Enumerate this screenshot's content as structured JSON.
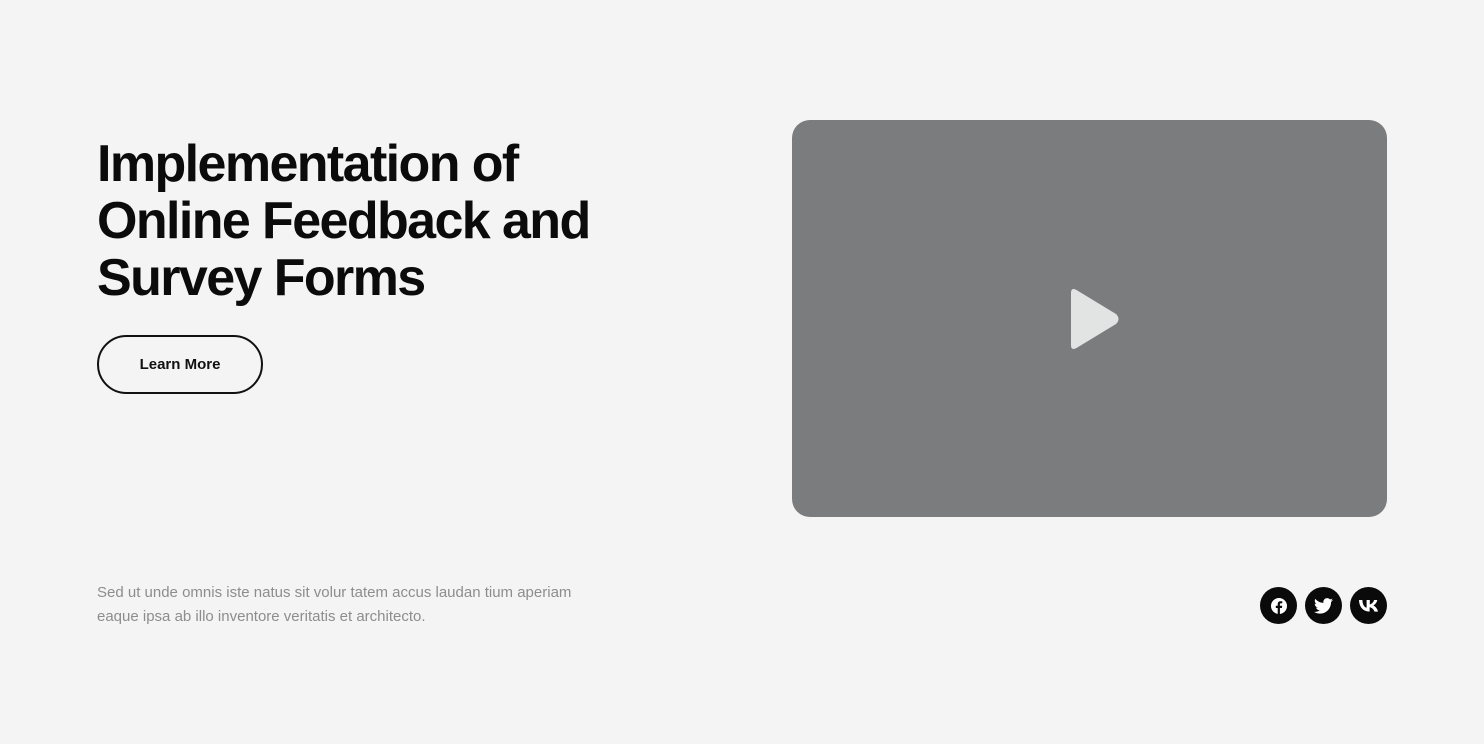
{
  "hero": {
    "title_line1": "Implementation of",
    "title_line2": "Online Feedback and",
    "title_line3": "Survey Forms",
    "button_label": "Learn More"
  },
  "video": {
    "icon": "play-icon"
  },
  "footer": {
    "description_line1": "Sed ut unde omnis iste natus sit volur tatem accus laudan tium aperiam",
    "description_line2": "eaque ipsa ab illo inventore veritatis et architecto."
  },
  "socials": [
    {
      "icon": "facebook-icon"
    },
    {
      "icon": "twitter-icon"
    },
    {
      "icon": "vk-icon"
    }
  ],
  "colors": {
    "background": "#f4f4f4",
    "video_placeholder": "#7b7c7e",
    "play_icon": "#e2e3e3",
    "text": "#0b0b0b",
    "muted_text": "#8d8d8d",
    "social_bg": "#0a0a0a"
  }
}
